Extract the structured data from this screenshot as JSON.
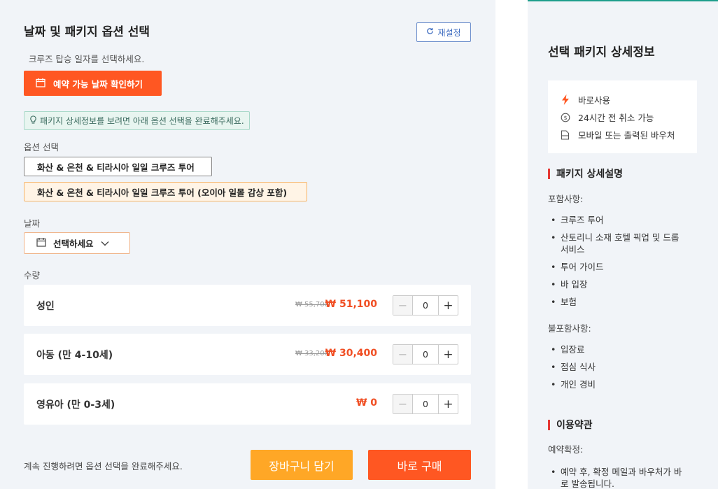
{
  "left": {
    "title": "날짜 및 패키지 옵션 선택",
    "reset_label": "재설정",
    "hint": "크루즈 탑승 일자를 선택하세요.",
    "check_dates_label": "예약 가능 날짜 확인하기",
    "notice": "패키지 상세정보를 보려면 아래 옵션 선택을 완료해주세요.",
    "option_label": "옵션 선택",
    "options": [
      "화산 & 온천 & 티라시아 일일 크루즈 투어",
      "화산 & 온천 & 티라시아 일일 크루즈 투어 (오이아 일몰 감상 포함)"
    ],
    "date_label": "날짜",
    "date_placeholder": "선택하세요",
    "qty_label": "수량",
    "rows": [
      {
        "name": "성인",
        "old_price": "₩ 55,700",
        "price": "₩ 51,100",
        "qty": "0"
      },
      {
        "name": "아동 (만 4-10세)",
        "old_price": "₩ 33,200",
        "price": "₩ 30,400",
        "qty": "0"
      },
      {
        "name": "영유아 (만 0-3세)",
        "old_price": "",
        "price": "₩ 0",
        "qty": "0"
      }
    ],
    "footer_note": "계속 진행하려면 옵션 선택을 완료해주세요.",
    "cart_label": "장바구니 담기",
    "buy_label": "바로 구매"
  },
  "right": {
    "title": "선택 패키지 상세정보",
    "features": [
      {
        "icon": "lightning-icon",
        "label": "바로사용"
      },
      {
        "icon": "refund-icon",
        "label": "24시간 전 취소 가능"
      },
      {
        "icon": "ticket-icon",
        "label": "모바일 또는 출력된 바우처"
      }
    ],
    "desc_title": "패키지 상세설명",
    "included_label": "포함사항:",
    "included": [
      "크루즈 투어",
      "산토리니 소재 호텔 픽업 및 드롭 서비스",
      "투어 가이드",
      "바 입장",
      "보험"
    ],
    "excluded_label": "불포함사항:",
    "excluded": [
      "입장료",
      "점심 식사",
      "개인 경비"
    ],
    "terms_title": "이용약관",
    "confirm_label": "예약확정:",
    "confirm_items": [
      "예약 후, 확정 메일과 바우처가 바로 발송됩니다."
    ]
  },
  "colors": {
    "accent": "#ff5722",
    "cart": "#ffa726",
    "price": "#f04e23",
    "teal": "#1e9e8c",
    "section_bar": "#e53935"
  }
}
